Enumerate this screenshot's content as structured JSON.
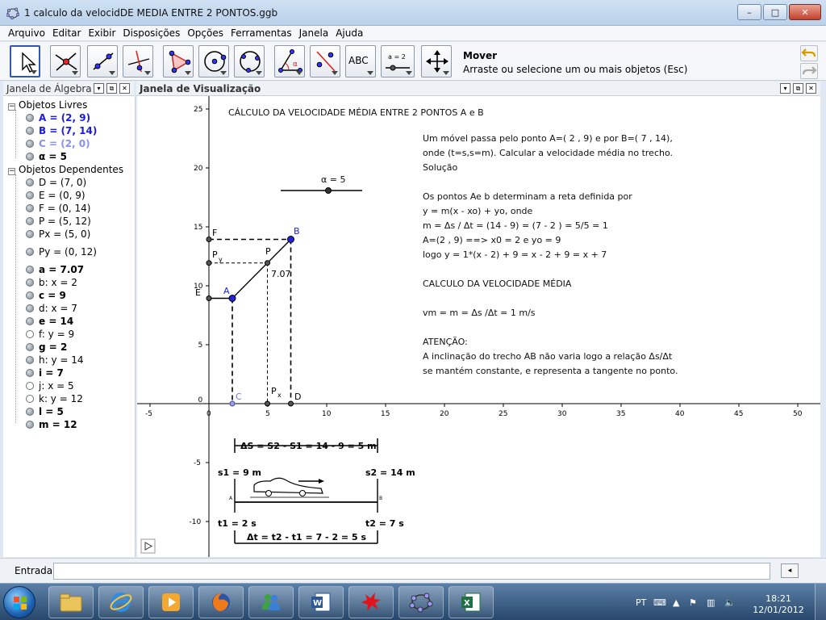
{
  "window": {
    "title": "1 calculo da velocidDE MEDIA ENTRE 2 PONTOS.ggb",
    "minimize": "–",
    "maximize": "□",
    "close": "✕"
  },
  "menu": [
    "Arquivo",
    "Editar",
    "Exibir",
    "Disposições",
    "Opções",
    "Ferramentas",
    "Janela",
    "Ajuda"
  ],
  "toolbar": {
    "abc_label": "ABC",
    "slider_label": "a = 2",
    "tool_name": "Mover",
    "tool_description": "Arraste ou selecione um ou mais objetos (Esc)"
  },
  "algebra": {
    "title": "Janela de Álgebra",
    "free_group": "Objetos Livres",
    "dependent_group": "Objetos Dependentes",
    "free_objects": [
      {
        "text": "A = (2, 9)",
        "color": "#1a1ae6",
        "filled": true
      },
      {
        "text": "B = (7, 14)",
        "color": "#1a1ae6",
        "filled": true
      },
      {
        "text": "C = (2, 0)",
        "color": "#8a8ff0",
        "filled": true
      },
      {
        "text": "α = 5",
        "color": "#000000",
        "filled": true
      }
    ],
    "dependent_objects": [
      {
        "text": "D = (7, 0)",
        "filled": true
      },
      {
        "text": "E = (0, 9)",
        "filled": true
      },
      {
        "text": "F = (0, 14)",
        "filled": true
      },
      {
        "text": "P = (5, 12)",
        "filled": true
      },
      {
        "text": "Px = (5, 0)",
        "filled": true
      },
      {
        "text": "Py = (0, 12)",
        "filled": true
      },
      {
        "text": "a = 7.07",
        "filled": true,
        "bold": true
      },
      {
        "text": "b: x = 2",
        "filled": true
      },
      {
        "text": "c = 9",
        "filled": true,
        "bold": true
      },
      {
        "text": "d: x = 7",
        "filled": true
      },
      {
        "text": "e = 14",
        "filled": true,
        "bold": true
      },
      {
        "text": "f: y = 9",
        "filled": false
      },
      {
        "text": "g = 2",
        "filled": true,
        "bold": true
      },
      {
        "text": "h: y = 14",
        "filled": true
      },
      {
        "text": "i = 7",
        "filled": true,
        "bold": true
      },
      {
        "text": "j: x = 5",
        "filled": false
      },
      {
        "text": "k: y = 12",
        "filled": false
      },
      {
        "text": "l = 5",
        "filled": true,
        "bold": true
      },
      {
        "text": "m = 12",
        "filled": true,
        "bold": true
      }
    ]
  },
  "graphics": {
    "title": "Janela de Visualização",
    "heading": "CÁLCULO DA VELOCIDADE MÉDIA ENTRE 2 PONTOS A e B",
    "slider_label": "α = 5",
    "explanation": [
      " Um móvel passa pelo ponto  A=( 2 , 9) e por B=( 7 , 14),",
      "onde (t=s,s=m). Calcular a velocidade média no trecho.",
      "Solução",
      "",
      "Os pontos Ae b determinam a reta definida por",
      "y = m(x - xo) + yo, onde",
      "m = Δs / Δt  =  (14 - 9) =  (7 - 2 ) =  5/5 = 1",
      "A=(2 , 9) ==>  x0 = 2 e yo = 9",
      "logo  y = 1*(x - 2)  +  9  =  x - 2 + 9  =  x  +  7",
      "",
      "CALCULO DA VELOCIDADE MÉDIA",
      "",
      "vm = m = Δs /Δt  = 1 m/s",
      "",
      "ATENÇÃO:",
      "A inclinação do trecho AB não varia logo a relação Δs/Δt",
      "se mantém constante, e representa a tangente no ponto."
    ],
    "x_ticks": [
      "-5",
      "0",
      "5",
      "10",
      "15",
      "20",
      "25",
      "30",
      "35",
      "40",
      "45",
      "50"
    ],
    "y_ticks": [
      "25",
      "20",
      "15",
      "10",
      "5",
      "0",
      "-5",
      "-10"
    ],
    "point_labels": {
      "A": "A",
      "B": "B",
      "C": "C",
      "D": "D",
      "E": "E",
      "F": "F",
      "P": "P",
      "Px": "P",
      "Px_sub": "x",
      "Py": "P",
      "Py_sub": "y"
    },
    "segment_label": "7.07",
    "diagram": {
      "delta_s": "ΔS = S2 - S1 = 14 - 9 = 5 m",
      "s1": "s1 = 9 m",
      "s2": "s2 = 14 m",
      "t1": "t1 = 2 s",
      "t2": "t2 = 7 s",
      "delta_t": "Δt = t2 - t1 = 7 - 2 = 5 s",
      "mark_a": "A",
      "mark_b": "B"
    }
  },
  "input": {
    "label": "Entrada:",
    "value": "",
    "keyboard": "◂"
  },
  "taskbar": {
    "language": "PT",
    "time": "18:21",
    "date": "12/01/2012",
    "abc_label": ""
  }
}
